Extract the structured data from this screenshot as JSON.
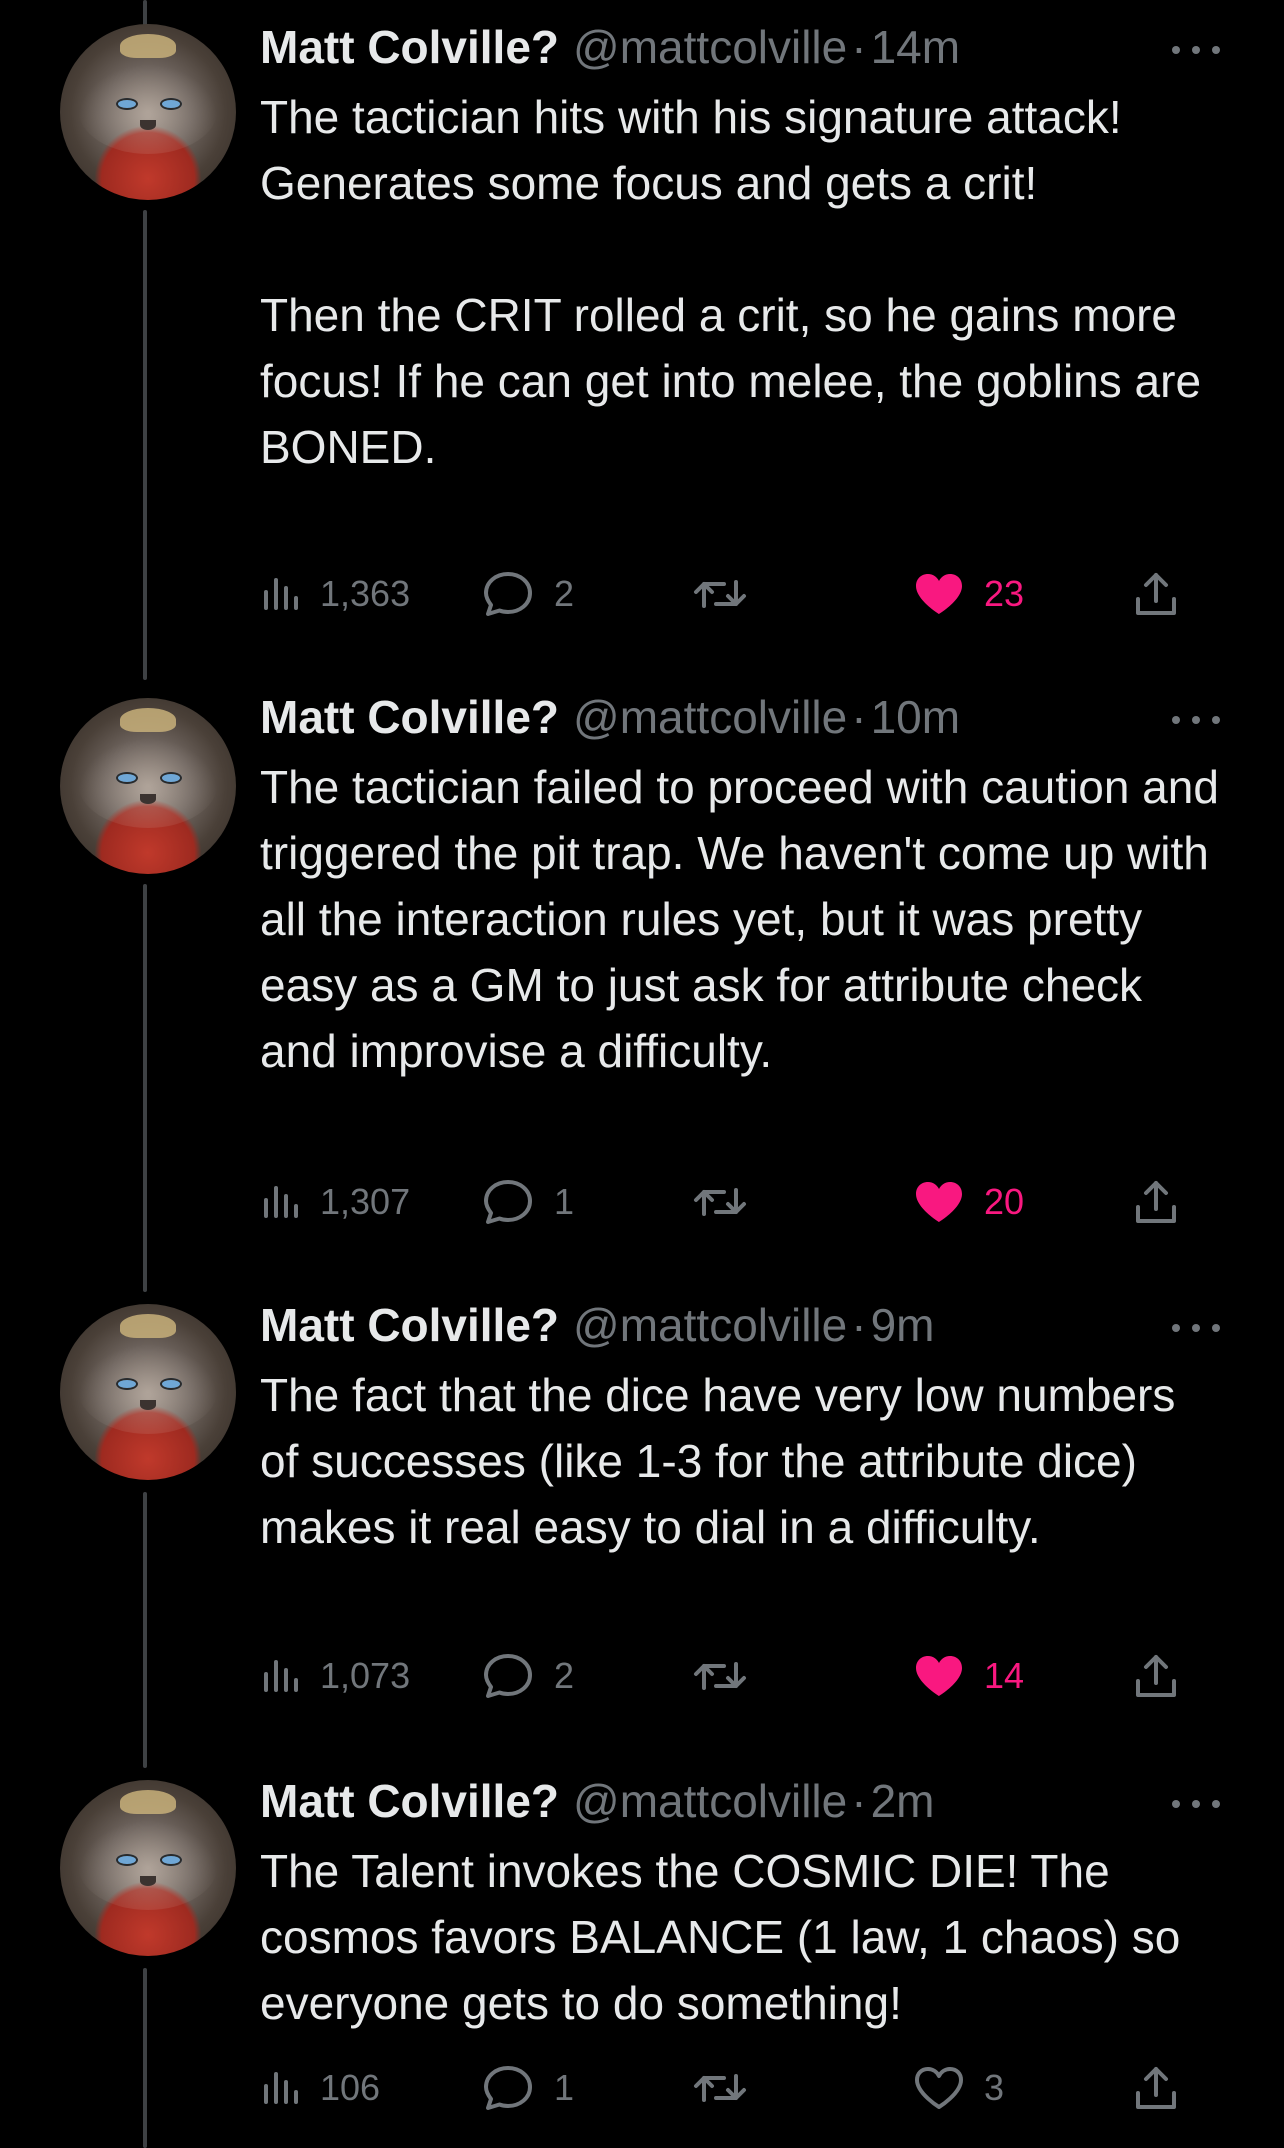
{
  "colors": {
    "background": "#000000",
    "text": "#e7e9ea",
    "muted": "#71767b",
    "like_active": "#f91880",
    "thread_line": "#3e4144"
  },
  "tweets": [
    {
      "name": "Matt Colville?",
      "handle": "@mattcolville",
      "separator": "·",
      "time": "14m",
      "text": "The tactician hits with his signature attack! Generates some focus and gets a crit!\n\nThen the CRIT rolled a crit, so he gains more focus! If he can get into melee, the goblins are BONED.",
      "views": "1,363",
      "replies": "2",
      "retweets": "",
      "likes": "23",
      "liked": true
    },
    {
      "name": "Matt Colville?",
      "handle": "@mattcolville",
      "separator": "·",
      "time": "10m",
      "text": "The tactician failed to proceed with caution and triggered the pit trap. We haven't come up with all the interaction rules yet, but it was pretty easy as a GM to just ask for attribute check and improvise a difficulty.",
      "views": "1,307",
      "replies": "1",
      "retweets": "",
      "likes": "20",
      "liked": true
    },
    {
      "name": "Matt Colville?",
      "handle": "@mattcolville",
      "separator": "·",
      "time": "9m",
      "text": "The fact that the dice have very low numbers of successes (like 1-3 for the attribute dice) makes it real easy to dial in a difficulty.",
      "views": "1,073",
      "replies": "2",
      "retweets": "",
      "likes": "14",
      "liked": true
    },
    {
      "name": "Matt Colville?",
      "handle": "@mattcolville",
      "separator": "·",
      "time": "2m",
      "text": "The Talent invokes the COSMIC DIE! The cosmos favors BALANCE (1 law, 1 chaos) so everyone gets to do something!",
      "views": "106",
      "replies": "1",
      "retweets": "",
      "likes": "3",
      "liked": false
    }
  ],
  "icons": {
    "views": "bar-chart-icon",
    "reply": "speech-bubble-icon",
    "retweet": "retweet-icon",
    "like": "heart-icon",
    "share": "share-upload-icon",
    "more": "more-dots-icon"
  }
}
